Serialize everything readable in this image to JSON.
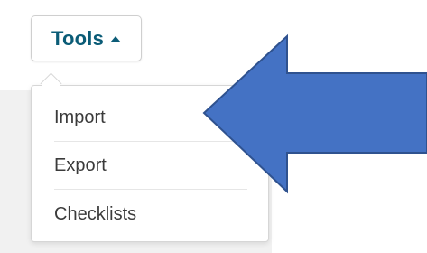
{
  "toolbar": {
    "tools_label": "Tools",
    "tools_icon": "caret-up-icon"
  },
  "menu": {
    "items": [
      {
        "label": "Import"
      },
      {
        "label": "Export"
      },
      {
        "label": "Checklists"
      }
    ]
  },
  "annotation": {
    "arrow_color": "#4472c4",
    "arrow_direction": "left"
  },
  "colors": {
    "accent": "#0b5c77",
    "menu_text": "#3b3b3b"
  }
}
